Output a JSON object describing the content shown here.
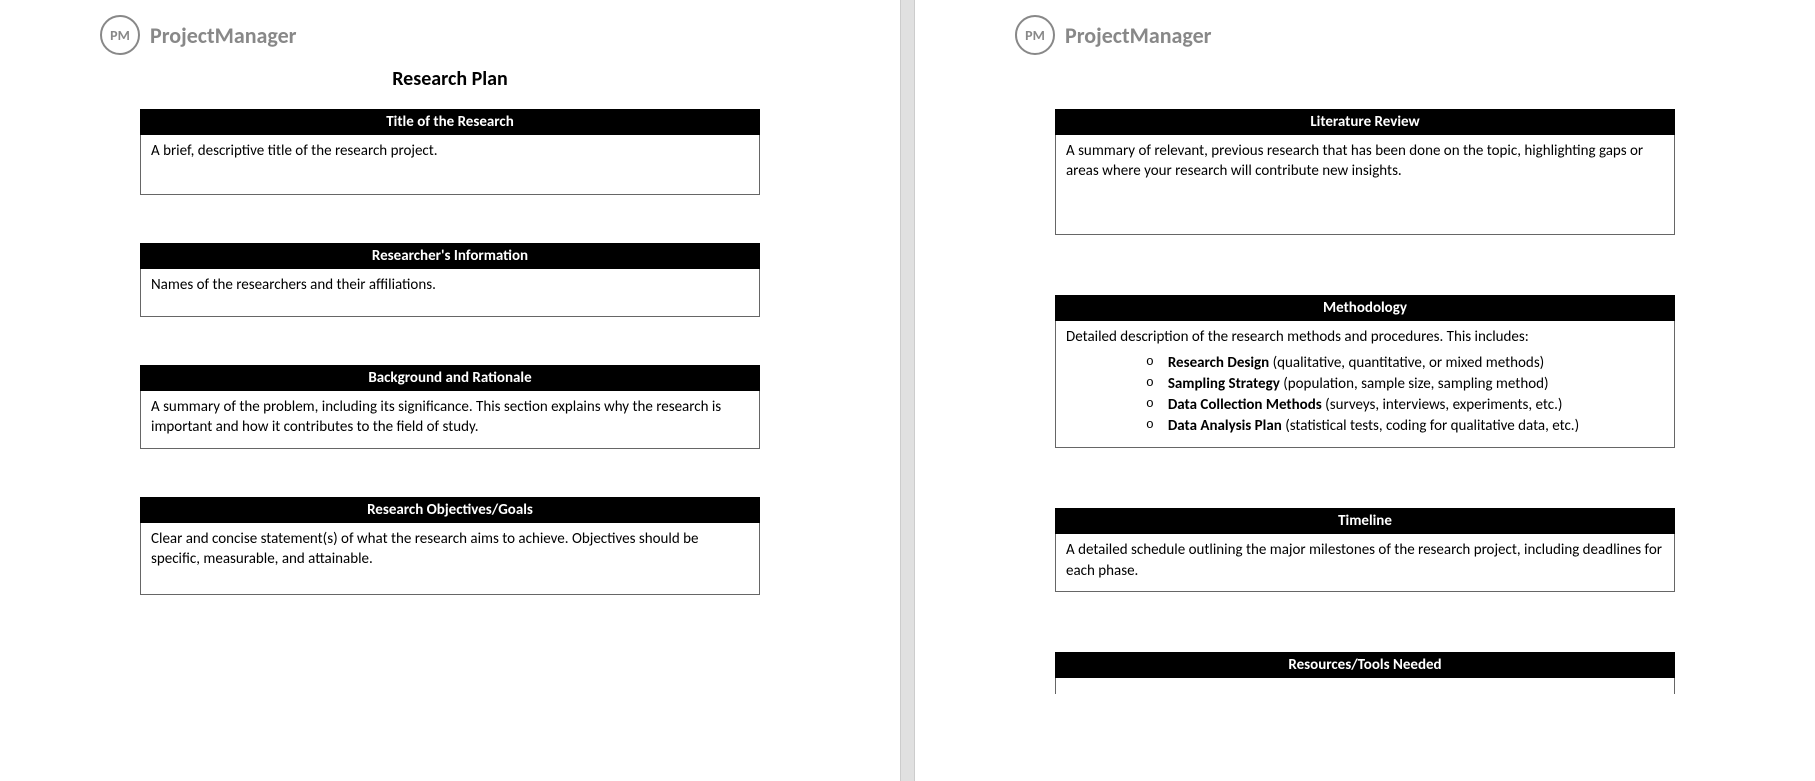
{
  "brand": {
    "logo_initials": "PM",
    "logo_text": "ProjectManager"
  },
  "document_title": "Research Plan",
  "page1": {
    "sections": [
      {
        "header": "Title of the Research",
        "body": "A brief, descriptive title of the research project."
      },
      {
        "header": "Researcher's Information",
        "body": "Names of the researchers and their affiliations."
      },
      {
        "header": "Background and Rationale",
        "body": "A summary of the problem, including its significance. This section explains why the research is important and how it contributes to the field of study."
      },
      {
        "header": "Research Objectives/Goals",
        "body": "Clear and concise statement(s) of what the research aims to achieve. Objectives should be specific, measurable, and attainable."
      }
    ]
  },
  "page2": {
    "literature_review": {
      "header": "Literature Review",
      "body": "A summary of relevant, previous research that has been done on the topic, highlighting gaps or areas where your research will contribute new insights."
    },
    "methodology": {
      "header": "Methodology",
      "intro": "Detailed description of the research methods and procedures. This includes:",
      "items": [
        {
          "label": "Research Design",
          "rest": " (qualitative, quantitative, or mixed methods)"
        },
        {
          "label": "Sampling Strategy",
          "rest": " (population, sample size, sampling method)"
        },
        {
          "label": "Data Collection Methods",
          "rest": " (surveys, interviews, experiments, etc.)"
        },
        {
          "label": "Data Analysis Plan",
          "rest": " (statistical tests, coding for qualitative data, etc.)"
        }
      ]
    },
    "timeline": {
      "header": "Timeline",
      "body": "A detailed schedule outlining the major milestones of the research project, including deadlines for each phase."
    },
    "resources": {
      "header": "Resources/Tools Needed"
    }
  },
  "bullet_char": "o"
}
